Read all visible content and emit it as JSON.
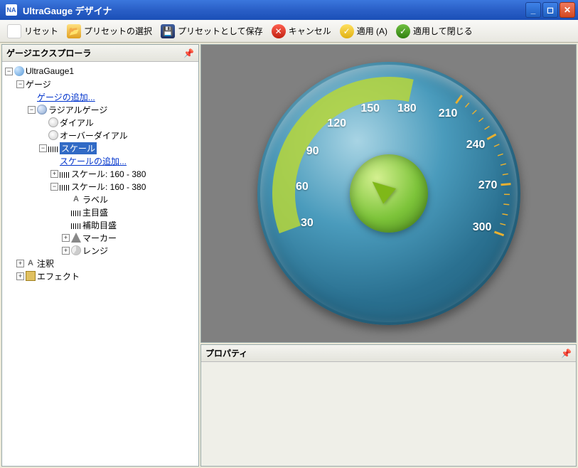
{
  "window": {
    "title": "UltraGauge デザイナ",
    "app_icon_text": "NA"
  },
  "toolbar": {
    "reset": "リセット",
    "open": "プリセットの選択",
    "save": "プリセットとして保存",
    "cancel": "キャンセル",
    "apply": "適用 (A)",
    "apply_close": "適用して閉じる"
  },
  "explorer": {
    "title": "ゲージエクスプローラ",
    "root": "UltraGauge1",
    "gauges": "ゲージ",
    "add_gauge": "ゲージの追加...",
    "radial_gauge": "ラジアルゲージ",
    "dial": "ダイアル",
    "over_dial": "オーバーダイアル",
    "scale": "スケール",
    "add_scale": "スケールの追加...",
    "scale1": "スケール: 160 - 380",
    "scale2": "スケール: 160 - 380",
    "label": "ラベル",
    "major_tick": "主目盛",
    "minor_tick": "補助目盛",
    "marker": "マーカー",
    "range": "レンジ",
    "annotation": "注釈",
    "effect": "エフェクト"
  },
  "properties": {
    "title": "プロパティ"
  },
  "chart_data": {
    "type": "gauge",
    "min": 30,
    "max": 300,
    "tick_interval": 30,
    "labels": [
      30,
      60,
      90,
      120,
      150,
      180,
      210,
      240,
      270,
      300
    ],
    "fill_segment": {
      "start": 30,
      "end": 180,
      "color": "#b6d63a"
    },
    "start_angle_deg": 200,
    "end_angle_deg": -20
  }
}
